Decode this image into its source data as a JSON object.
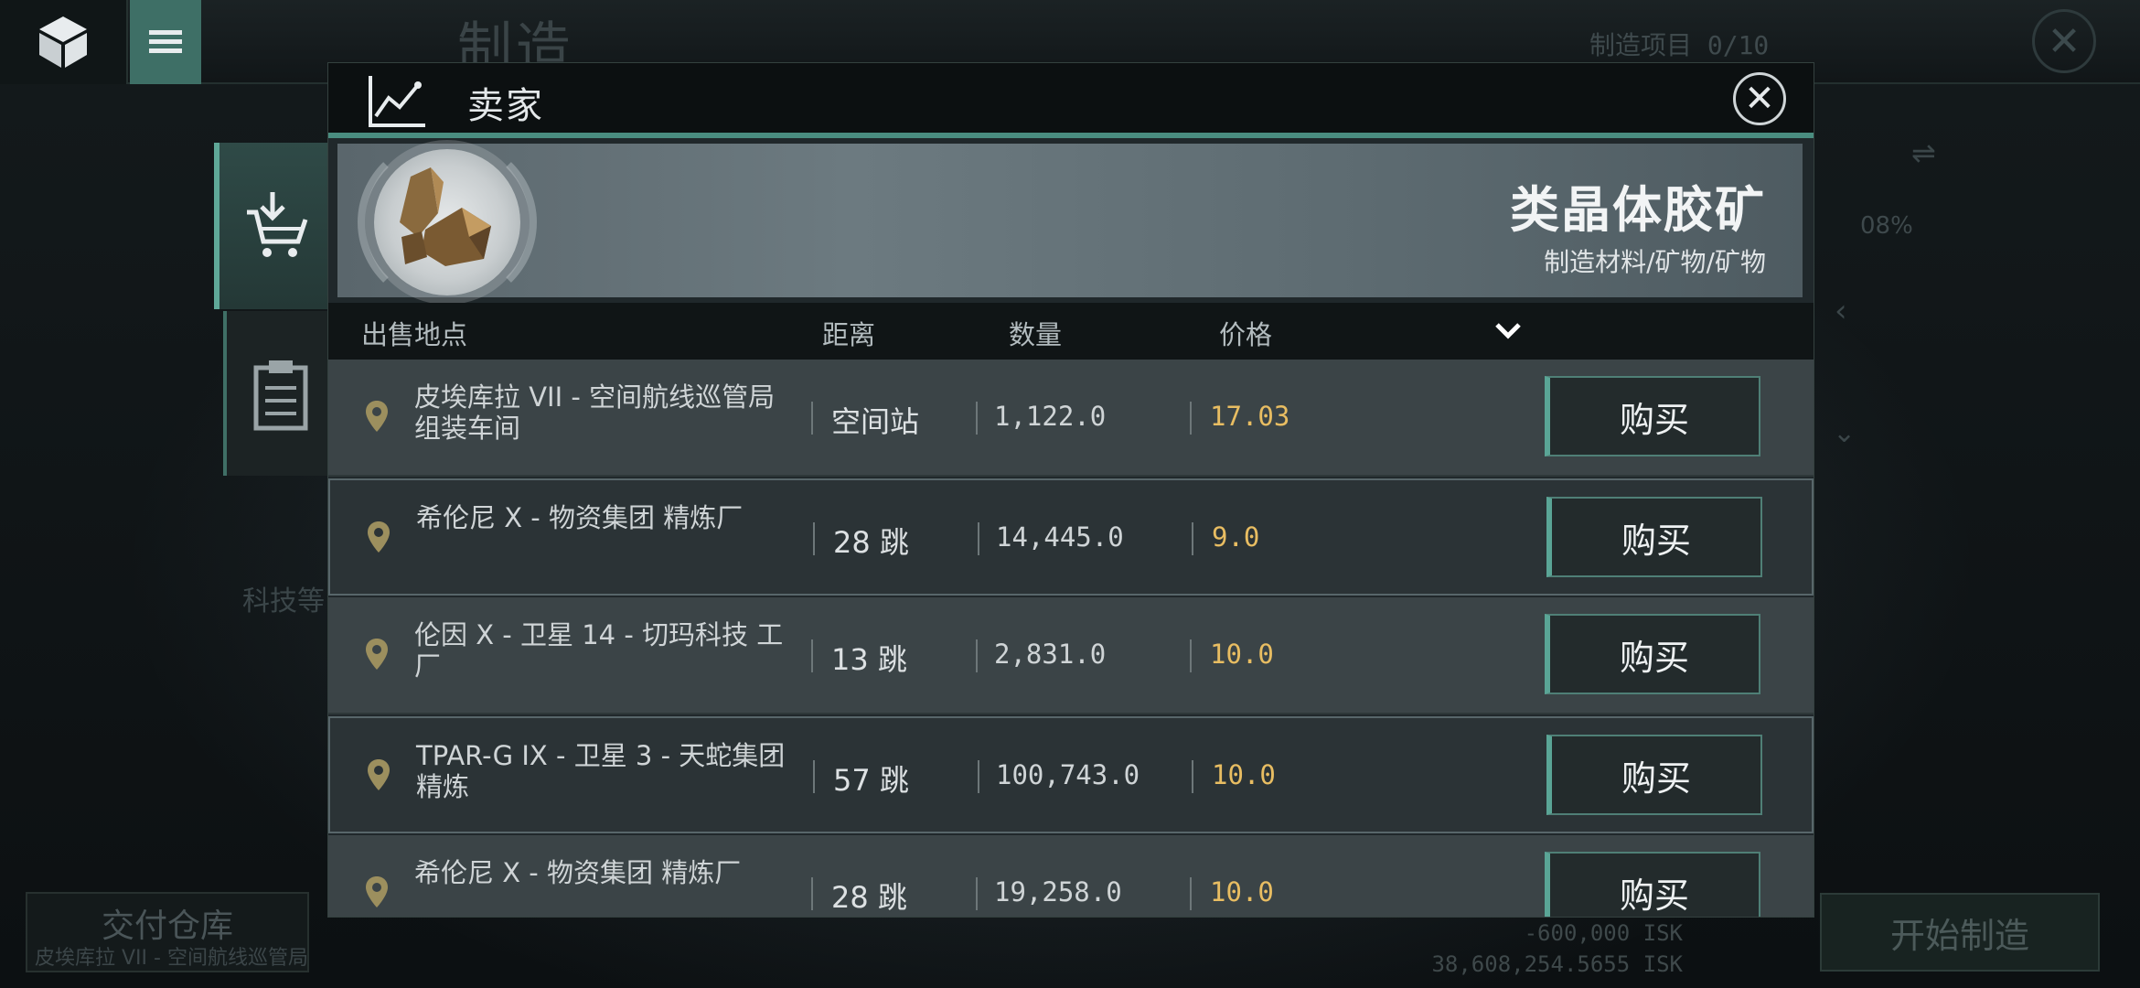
{
  "background": {
    "screen_title": "制造",
    "project_count": "制造项目 0/10",
    "percent": "08%",
    "tech_label": "科技等",
    "delivery": {
      "label": "交付仓库",
      "location": "皮埃库拉 VII - 空间航线巡管局 组装车间"
    },
    "cost": "-600,000 ISK",
    "total": "38,608,254.5655 ISK",
    "start_button": "开始制造"
  },
  "modal": {
    "title": "卖家",
    "item": {
      "name": "类晶体胶矿",
      "category": "制造材料/矿物/矿物",
      "icon": "crystal-ore-icon"
    },
    "columns": {
      "location": "出售地点",
      "distance": "距离",
      "quantity": "数量",
      "price": "价格"
    },
    "rows": [
      {
        "location": "皮埃库拉 VII - 空间航线巡管局 组装车间",
        "distance": "空间站",
        "quantity": "1,122.0",
        "price": "17.03",
        "buy": "购买"
      },
      {
        "location": "希伦尼 X - 物资集团 精炼厂",
        "distance": "28 跳",
        "quantity": "14,445.0",
        "price": "9.0",
        "buy": "购买"
      },
      {
        "location": "伦因 X - 卫星 14 - 切玛科技 工厂",
        "distance": "13 跳",
        "quantity": "2,831.0",
        "price": "10.0",
        "buy": "购买"
      },
      {
        "location": "TPAR-G IX - 卫星 3 - 天蛇集团 精炼",
        "distance": "57 跳",
        "quantity": "100,743.0",
        "price": "10.0",
        "buy": "购买"
      },
      {
        "location": "希伦尼 X - 物资集团 精炼厂",
        "distance": "28 跳",
        "quantity": "19,258.0",
        "price": "10.0",
        "buy": "购买"
      }
    ]
  },
  "colors": {
    "accent": "#5aa596",
    "price": "#e8bd62"
  }
}
